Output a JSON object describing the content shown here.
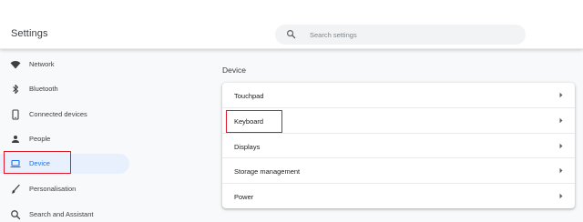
{
  "header": {
    "title": "Settings"
  },
  "search": {
    "placeholder": "Search settings",
    "value": ""
  },
  "sidebar": {
    "items": [
      {
        "label": "Network",
        "icon": "wifi-icon",
        "active": false
      },
      {
        "label": "Bluetooth",
        "icon": "bluetooth-icon",
        "active": false
      },
      {
        "label": "Connected devices",
        "icon": "phone-icon",
        "active": false
      },
      {
        "label": "People",
        "icon": "person-icon",
        "active": false
      },
      {
        "label": "Device",
        "icon": "laptop-icon",
        "active": true
      },
      {
        "label": "Personalisation",
        "icon": "brush-icon",
        "active": false
      },
      {
        "label": "Search and Assistant",
        "icon": "search-icon",
        "active": false
      }
    ]
  },
  "main": {
    "section_title": "Device",
    "rows": [
      {
        "label": "Touchpad"
      },
      {
        "label": "Keyboard"
      },
      {
        "label": "Displays"
      },
      {
        "label": "Storage management"
      },
      {
        "label": "Power"
      }
    ]
  },
  "colors": {
    "accent": "#1a73e8",
    "highlight_box": "#e0192a",
    "active_bg": "#e8f0fe"
  }
}
